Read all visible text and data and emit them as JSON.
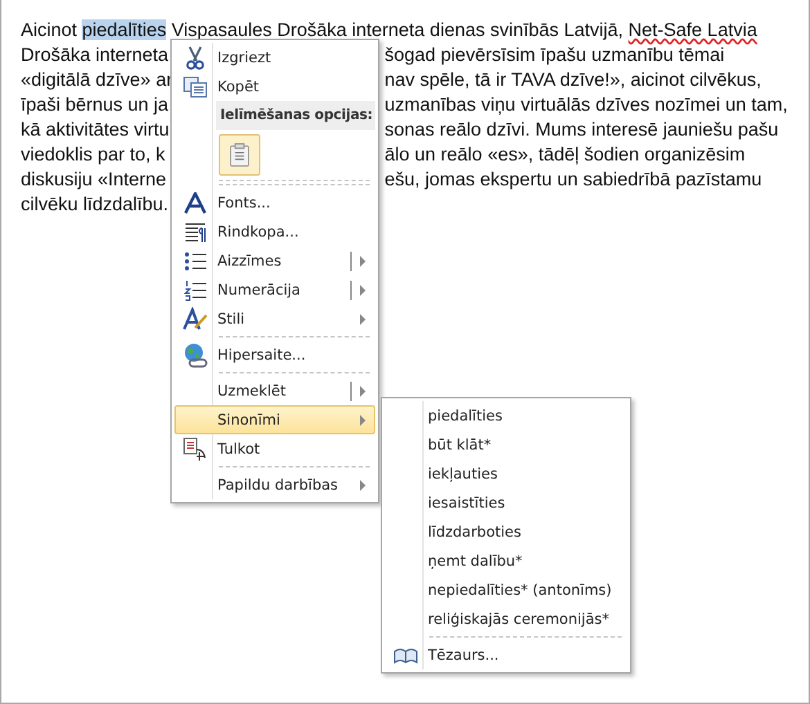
{
  "document": {
    "lines": [
      {
        "parts": [
          {
            "text": "Aicinot "
          },
          {
            "text": "piedalīties",
            "selected": true
          },
          {
            "text": " Vispasaules Drošāka interneta dienas svinībās Latvijā, "
          },
          {
            "text": "Net-Safe Latvia",
            "misspelled": true
          }
        ]
      },
      {
        "left": "Drošāka interneta",
        "right": "šogad pievērsīsim īpašu uzmanību tēmai"
      },
      {
        "left": "«digitālā dzīve» ar",
        "right": "nav spēle, tā ir TAVA dzīve!», aicinot cilvēkus,"
      },
      {
        "left": "īpaši bērnus un ja",
        "right": "uzmanības viņu virtuālās dzīves nozīmei un tam,"
      },
      {
        "left": "kā aktivitātes virtu",
        "right": "sonas reālo dzīvi. Mums interesē jauniešu pašu"
      },
      {
        "left": "viedoklis par to, k",
        "right": "ālo un reālo «es», tādēļ šodien organizēsim"
      },
      {
        "left": "diskusiju «Interne",
        "right": "ešu, jomas ekspertu un sabiedrībā pazīstamu"
      },
      {
        "left": "cilvēku līdzdalību."
      }
    ]
  },
  "context_menu": {
    "items": [
      {
        "kind": "item",
        "label": "Izgriezt",
        "selected": false,
        "submenu": false
      },
      {
        "kind": "item",
        "label": "Kopēt",
        "selected": false,
        "submenu": false
      },
      {
        "kind": "header",
        "label": "Ielīmēšanas opcijas:"
      },
      {
        "kind": "paste"
      },
      {
        "kind": "item",
        "label": "Fonts...",
        "selected": false,
        "submenu": false,
        "divider_above": true
      },
      {
        "kind": "item",
        "label": "Rindkopa...",
        "selected": false,
        "submenu": false
      },
      {
        "kind": "item",
        "label": "Aizzīmes",
        "selected": false,
        "submenu": true,
        "split": true
      },
      {
        "kind": "item",
        "label": "Numerācija",
        "selected": false,
        "submenu": true,
        "split": true
      },
      {
        "kind": "item",
        "label": "Stili",
        "selected": false,
        "submenu": true
      },
      {
        "kind": "item",
        "label": "Hipersaite...",
        "selected": false,
        "submenu": false,
        "divider_above": true
      },
      {
        "kind": "item",
        "label": "Uzmeklēt",
        "selected": false,
        "submenu": true,
        "split": true,
        "divider_above": true
      },
      {
        "kind": "item",
        "label": "Sinonīmi",
        "selected": true,
        "submenu": true
      },
      {
        "kind": "item",
        "label": "Tulkot",
        "selected": false,
        "submenu": false
      },
      {
        "kind": "item",
        "label": "Papildu darbības",
        "selected": false,
        "submenu": true,
        "divider_above": true
      }
    ]
  },
  "synonyms_menu": {
    "items": [
      {
        "label": "piedalīties",
        "selected": false
      },
      {
        "label": "būt klāt*",
        "selected": false
      },
      {
        "label": "iekļauties",
        "selected": false
      },
      {
        "label": "iesaistīties",
        "selected": false
      },
      {
        "label": "līdzdarboties",
        "selected": false
      },
      {
        "label": "ņemt dalību*",
        "selected": false
      },
      {
        "label": "nepiedalīties* (antonīms)",
        "selected": false
      },
      {
        "label": "reliģiskajās ceremonijās*",
        "selected": false
      },
      {
        "label": "Tēzaurs...",
        "selected": false,
        "divider_above": true
      }
    ]
  }
}
